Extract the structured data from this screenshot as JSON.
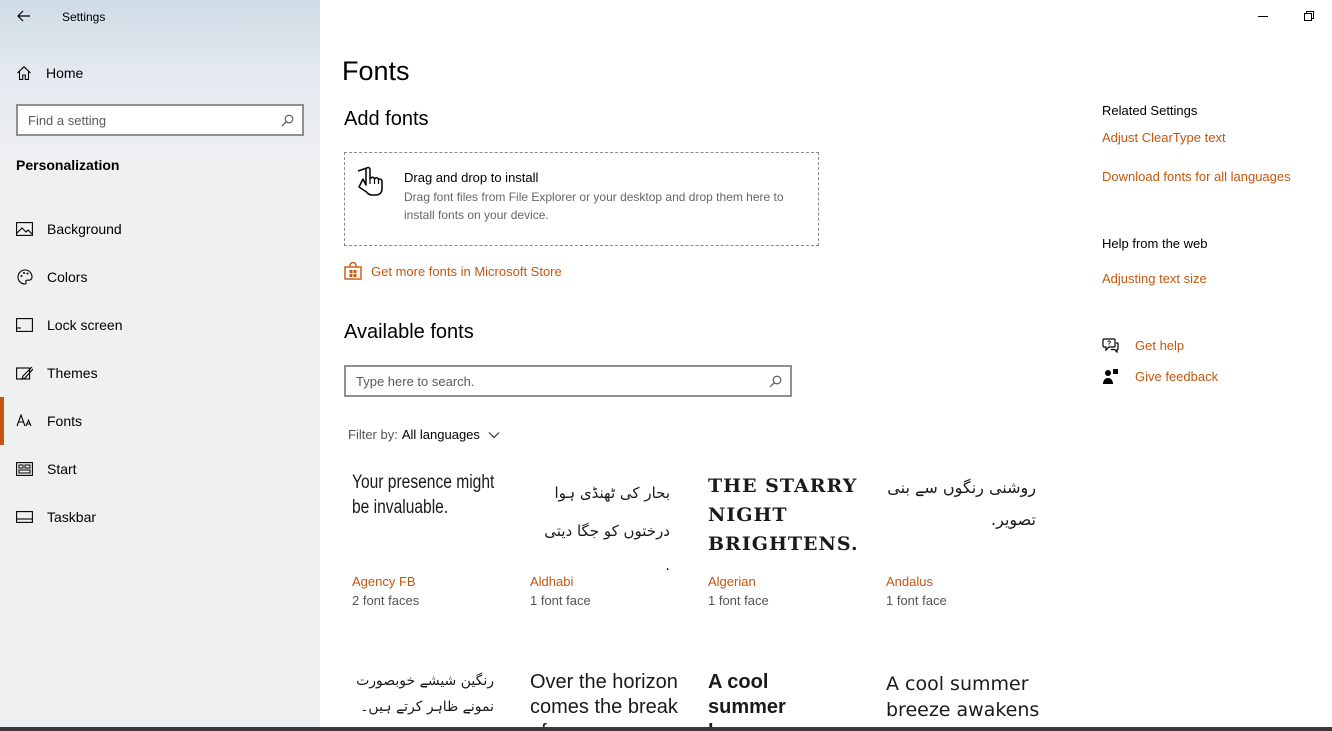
{
  "window": {
    "title": "Settings"
  },
  "sidebar": {
    "home_label": "Home",
    "search_placeholder": "Find a setting",
    "section": "Personalization",
    "items": [
      {
        "label": "Background",
        "icon": "image-icon"
      },
      {
        "label": "Colors",
        "icon": "palette-icon"
      },
      {
        "label": "Lock screen",
        "icon": "lock-screen-icon"
      },
      {
        "label": "Themes",
        "icon": "themes-icon"
      },
      {
        "label": "Fonts",
        "icon": "fonts-icon",
        "active": true
      },
      {
        "label": "Start",
        "icon": "start-icon"
      },
      {
        "label": "Taskbar",
        "icon": "taskbar-icon"
      }
    ]
  },
  "main": {
    "title": "Fonts",
    "add_fonts": {
      "heading": "Add fonts",
      "drop_title": "Drag and drop to install",
      "drop_desc": "Drag font files from File Explorer or your desktop and drop them here to install fonts on your device.",
      "store_link": "Get more fonts in Microsoft Store"
    },
    "available": {
      "heading": "Available fonts",
      "search_placeholder": "Type here to search.",
      "filter_label": "Filter by:",
      "filter_value": "All languages"
    },
    "fonts": [
      {
        "preview": "Your presence might be invaluable.",
        "name": "Agency FB",
        "faces": "2 font faces"
      },
      {
        "preview": "بحار کی ٹھنڈی ہوا درختوں کو جگا دیتی ہے۔",
        "name": "Aldhabi",
        "faces": "1 font face"
      },
      {
        "preview": "THE STARRY NIGHT BRIGHTENS...",
        "name": "Algerian",
        "faces": "1 font face"
      },
      {
        "preview": "روشنی رنگوں سے بنی تصویر.",
        "name": "Andalus",
        "faces": "1 font face"
      },
      {
        "preview": "رنگین شیشے خوبصورت نمونے ظاہر کرتے ہیں۔",
        "name": "",
        "faces": ""
      },
      {
        "preview": "Over the horizon comes the break of",
        "name": "",
        "faces": ""
      },
      {
        "preview": "A cool summer breeze",
        "name": "",
        "faces": ""
      },
      {
        "preview": "A cool summer breeze awakens the",
        "name": "",
        "faces": ""
      }
    ]
  },
  "related": {
    "heading": "Related Settings",
    "links": [
      "Adjust ClearType text",
      "Download fonts for all languages"
    ],
    "web_heading": "Help from the web",
    "web_links": [
      "Adjusting text size"
    ],
    "get_help": "Get help",
    "give_feedback": "Give feedback"
  },
  "colors": {
    "accent": "#c4570f"
  }
}
